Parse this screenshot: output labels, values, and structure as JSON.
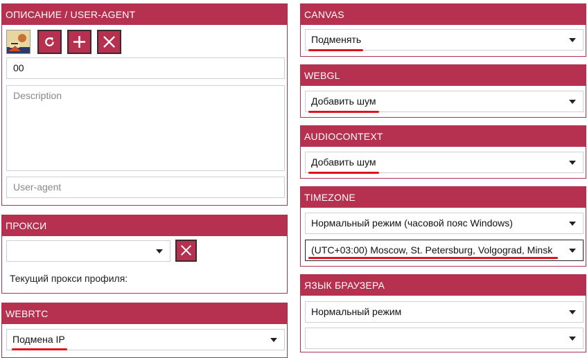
{
  "description_panel": {
    "title": "ОПИСАНИЕ / USER-AGENT",
    "name_value": "00",
    "description_placeholder": "Description",
    "user_agent_placeholder": "User-agent"
  },
  "proxy_panel": {
    "title": "ПРОКСИ",
    "proxy_value": "",
    "current_proxy_label": "Текущий прокси профиля:"
  },
  "webrtc_panel": {
    "title": "WEBRTC",
    "value": "Подмена IP"
  },
  "canvas_panel": {
    "title": "CANVAS",
    "value": "Подменять"
  },
  "webgl_panel": {
    "title": "WEBGL",
    "value": "Добавить шум"
  },
  "audiocontext_panel": {
    "title": "AUDIOCONTEXT",
    "value": "Добавить шум"
  },
  "timezone_panel": {
    "title": "TIMEZONE",
    "mode_value": "Нормальный режим (часовой пояс Windows)",
    "zone_value": "(UTC+03:00) Moscow, St. Petersburg, Volgograd, Minsk"
  },
  "language_panel": {
    "title": "ЯЗЫК БРАУЗЕРА",
    "mode_value": "Нормальный режим",
    "language_value": ""
  },
  "colors": {
    "accent": "#b5314f",
    "highlight": "#e0101c"
  }
}
